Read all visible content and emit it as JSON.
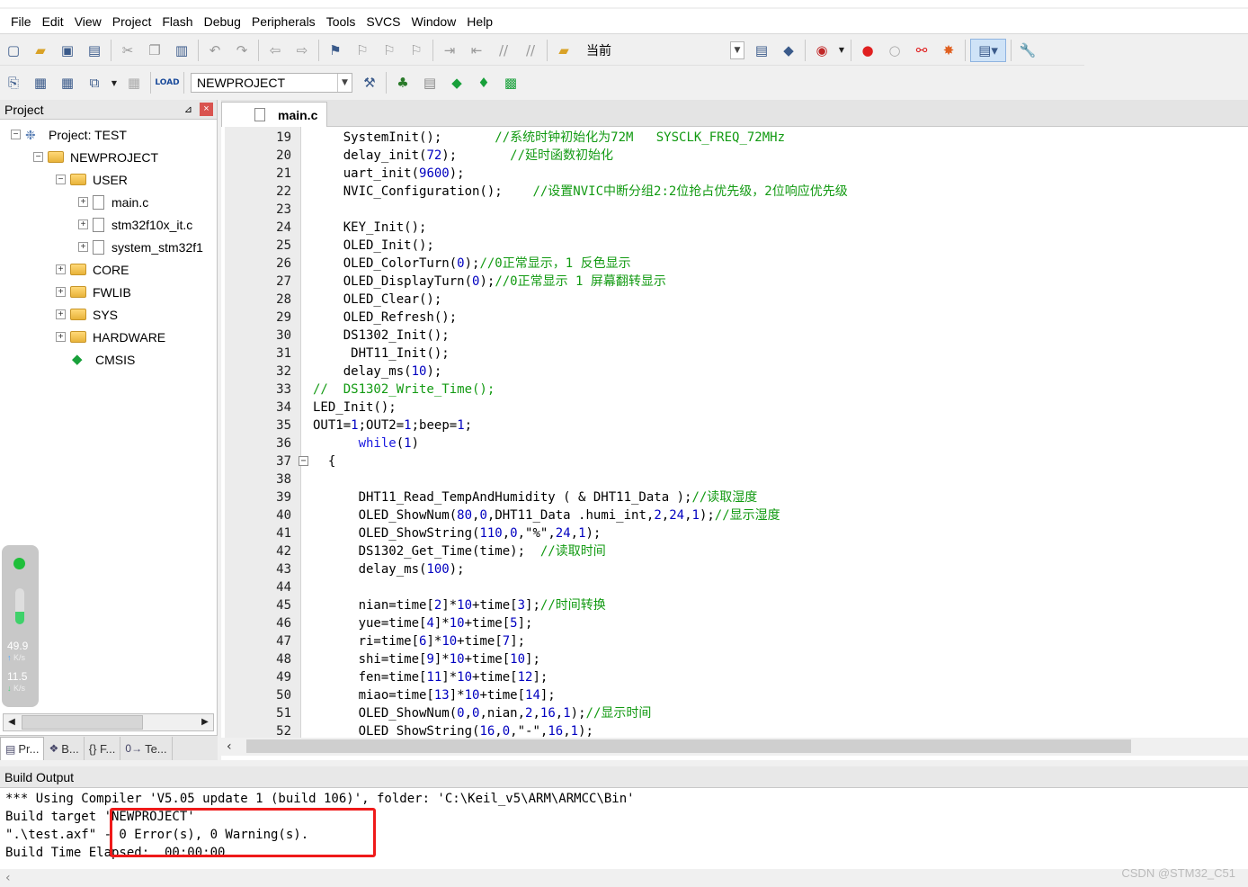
{
  "menubar": {
    "items": [
      "File",
      "Edit",
      "View",
      "Project",
      "Flash",
      "Debug",
      "Peripherals",
      "Tools",
      "SVCS",
      "Window",
      "Help"
    ]
  },
  "toolbar": {
    "target_combo": "当前",
    "project_combo": "NEWPROJECT"
  },
  "project_panel": {
    "title": "Project",
    "pin_glyph": "⊿",
    "close_glyph": "×",
    "tree": {
      "root": "Project: TEST",
      "target": "NEWPROJECT",
      "groups": [
        {
          "label": "USER",
          "files": [
            "main.c",
            "stm32f10x_it.c",
            "system_stm32f1"
          ]
        },
        {
          "label": "CORE"
        },
        {
          "label": "FWLIB"
        },
        {
          "label": "SYS"
        },
        {
          "label": "HARDWARE"
        }
      ],
      "cmsis": "CMSIS"
    },
    "tabs": [
      "Pr...",
      "B...",
      "{} F...",
      "Te..."
    ]
  },
  "network": {
    "upload": "49.9",
    "upload_unit": "K/s",
    "download": "11.5",
    "download_unit": "K/s",
    "level": 0.35
  },
  "editor": {
    "tab": "main.c",
    "lines": [
      {
        "n": "19",
        "code": "    SystemInit();       ",
        "cmt": "//系统时钟初始化为72M   SYSCLK_FREQ_72MHz"
      },
      {
        "n": "20",
        "code": "    delay_init(72);       ",
        "cmt": "//延时函数初始化"
      },
      {
        "n": "21",
        "code": "    uart_init(9600);",
        "cmt": ""
      },
      {
        "n": "22",
        "code": "    NVIC_Configuration();    ",
        "cmt": "//设置NVIC中断分组2:2位抢占优先级，2位响应优先级"
      },
      {
        "n": "23",
        "code": "",
        "cmt": ""
      },
      {
        "n": "24",
        "code": "    KEY_Init();",
        "cmt": ""
      },
      {
        "n": "25",
        "code": "    OLED_Init();",
        "cmt": ""
      },
      {
        "n": "26",
        "code": "    OLED_ColorTurn(0);",
        "cmt": "//0正常显示，1 反色显示"
      },
      {
        "n": "27",
        "code": "    OLED_DisplayTurn(0);",
        "cmt": "//0正常显示 1 屏幕翻转显示"
      },
      {
        "n": "28",
        "code": "    OLED_Clear();",
        "cmt": ""
      },
      {
        "n": "29",
        "code": "    OLED_Refresh();",
        "cmt": ""
      },
      {
        "n": "30",
        "code": "    DS1302_Init();",
        "cmt": ""
      },
      {
        "n": "31",
        "code": "     DHT11_Init();",
        "cmt": ""
      },
      {
        "n": "32",
        "code": "    delay_ms(10);",
        "cmt": ""
      },
      {
        "n": "33",
        "code": "",
        "cmt": "//  DS1302_Write_Time();"
      },
      {
        "n": "34",
        "code": "LED_Init();",
        "cmt": ""
      },
      {
        "n": "35",
        "code": "OUT1=1;OUT2=1;beep=1;",
        "cmt": ""
      },
      {
        "n": "36",
        "code": "      while(1)",
        "cmt": ""
      },
      {
        "n": "37",
        "code": "  {",
        "cmt": ""
      },
      {
        "n": "38",
        "code": "",
        "cmt": ""
      },
      {
        "n": "39",
        "code": "      DHT11_Read_TempAndHumidity ( & DHT11_Data );",
        "cmt": "//读取湿度"
      },
      {
        "n": "40",
        "code": "      OLED_ShowNum(80,0,DHT11_Data .humi_int,2,24,1);",
        "cmt": "//显示湿度"
      },
      {
        "n": "41",
        "code": "      OLED_ShowString(110,0,\"%\",24,1);",
        "cmt": ""
      },
      {
        "n": "42",
        "code": "      DS1302_Get_Time(time);  ",
        "cmt": "//读取时间"
      },
      {
        "n": "43",
        "code": "      delay_ms(100);",
        "cmt": ""
      },
      {
        "n": "44",
        "code": "",
        "cmt": ""
      },
      {
        "n": "45",
        "code": "      nian=time[2]*10+time[3];",
        "cmt": "//时间转换"
      },
      {
        "n": "46",
        "code": "      yue=time[4]*10+time[5];",
        "cmt": ""
      },
      {
        "n": "47",
        "code": "      ri=time[6]*10+time[7];",
        "cmt": ""
      },
      {
        "n": "48",
        "code": "      shi=time[9]*10+time[10];",
        "cmt": ""
      },
      {
        "n": "49",
        "code": "      fen=time[11]*10+time[12];",
        "cmt": ""
      },
      {
        "n": "50",
        "code": "      miao=time[13]*10+time[14];",
        "cmt": ""
      },
      {
        "n": "51",
        "code": "      OLED_ShowNum(0,0,nian,2,16,1);",
        "cmt": "//显示时间"
      },
      {
        "n": "52",
        "code": "      OLED_ShowString(16,0,\"-\",16,1);",
        "cmt": ""
      }
    ]
  },
  "build_output": {
    "title": "Build Output",
    "lines": [
      "*** Using Compiler 'V5.05 update 1 (build 106)', folder: 'C:\\Keil_v5\\ARM\\ARMCC\\Bin'",
      "Build target 'NEWPROJECT'",
      "\".\\test.axf\" - 0 Error(s), 0 Warning(s).",
      "Build Time Elapsed:  00:00:00"
    ]
  },
  "watermark": "CSDN @STM32_C51",
  "colors": {
    "comment": "#129a12",
    "number": "#0000c0",
    "keyword": "#1a1ae0",
    "highlight_box": "#ef1a1a"
  }
}
